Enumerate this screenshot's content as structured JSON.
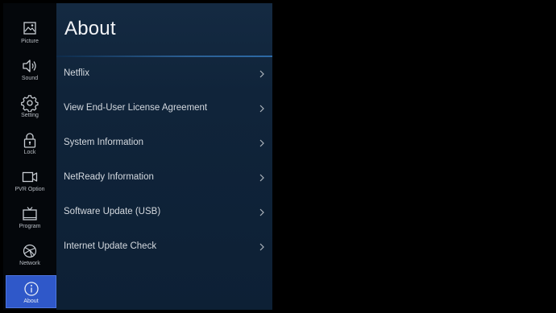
{
  "sidebar": {
    "items": [
      {
        "label": "Picture",
        "icon": "picture-icon"
      },
      {
        "label": "Sound",
        "icon": "speaker-icon"
      },
      {
        "label": "Setting",
        "icon": "gear-icon"
      },
      {
        "label": "Lock",
        "icon": "lock-icon"
      },
      {
        "label": "PVR Option",
        "icon": "video-camera-icon"
      },
      {
        "label": "Program",
        "icon": "tv-icon"
      },
      {
        "label": "Network",
        "icon": "globe-icon"
      },
      {
        "label": "About",
        "icon": "info-icon",
        "active": true
      }
    ]
  },
  "panel": {
    "title": "About",
    "items": [
      {
        "label": "Netflix"
      },
      {
        "label": "View End-User License Agreement"
      },
      {
        "label": "System Information"
      },
      {
        "label": "NetReady Information"
      },
      {
        "label": "Software Update (USB)"
      },
      {
        "label": "Internet Update Check"
      }
    ]
  },
  "colors": {
    "active_highlight": "#2f58c9",
    "panel_bg": "#10243a",
    "background": "#000000"
  }
}
